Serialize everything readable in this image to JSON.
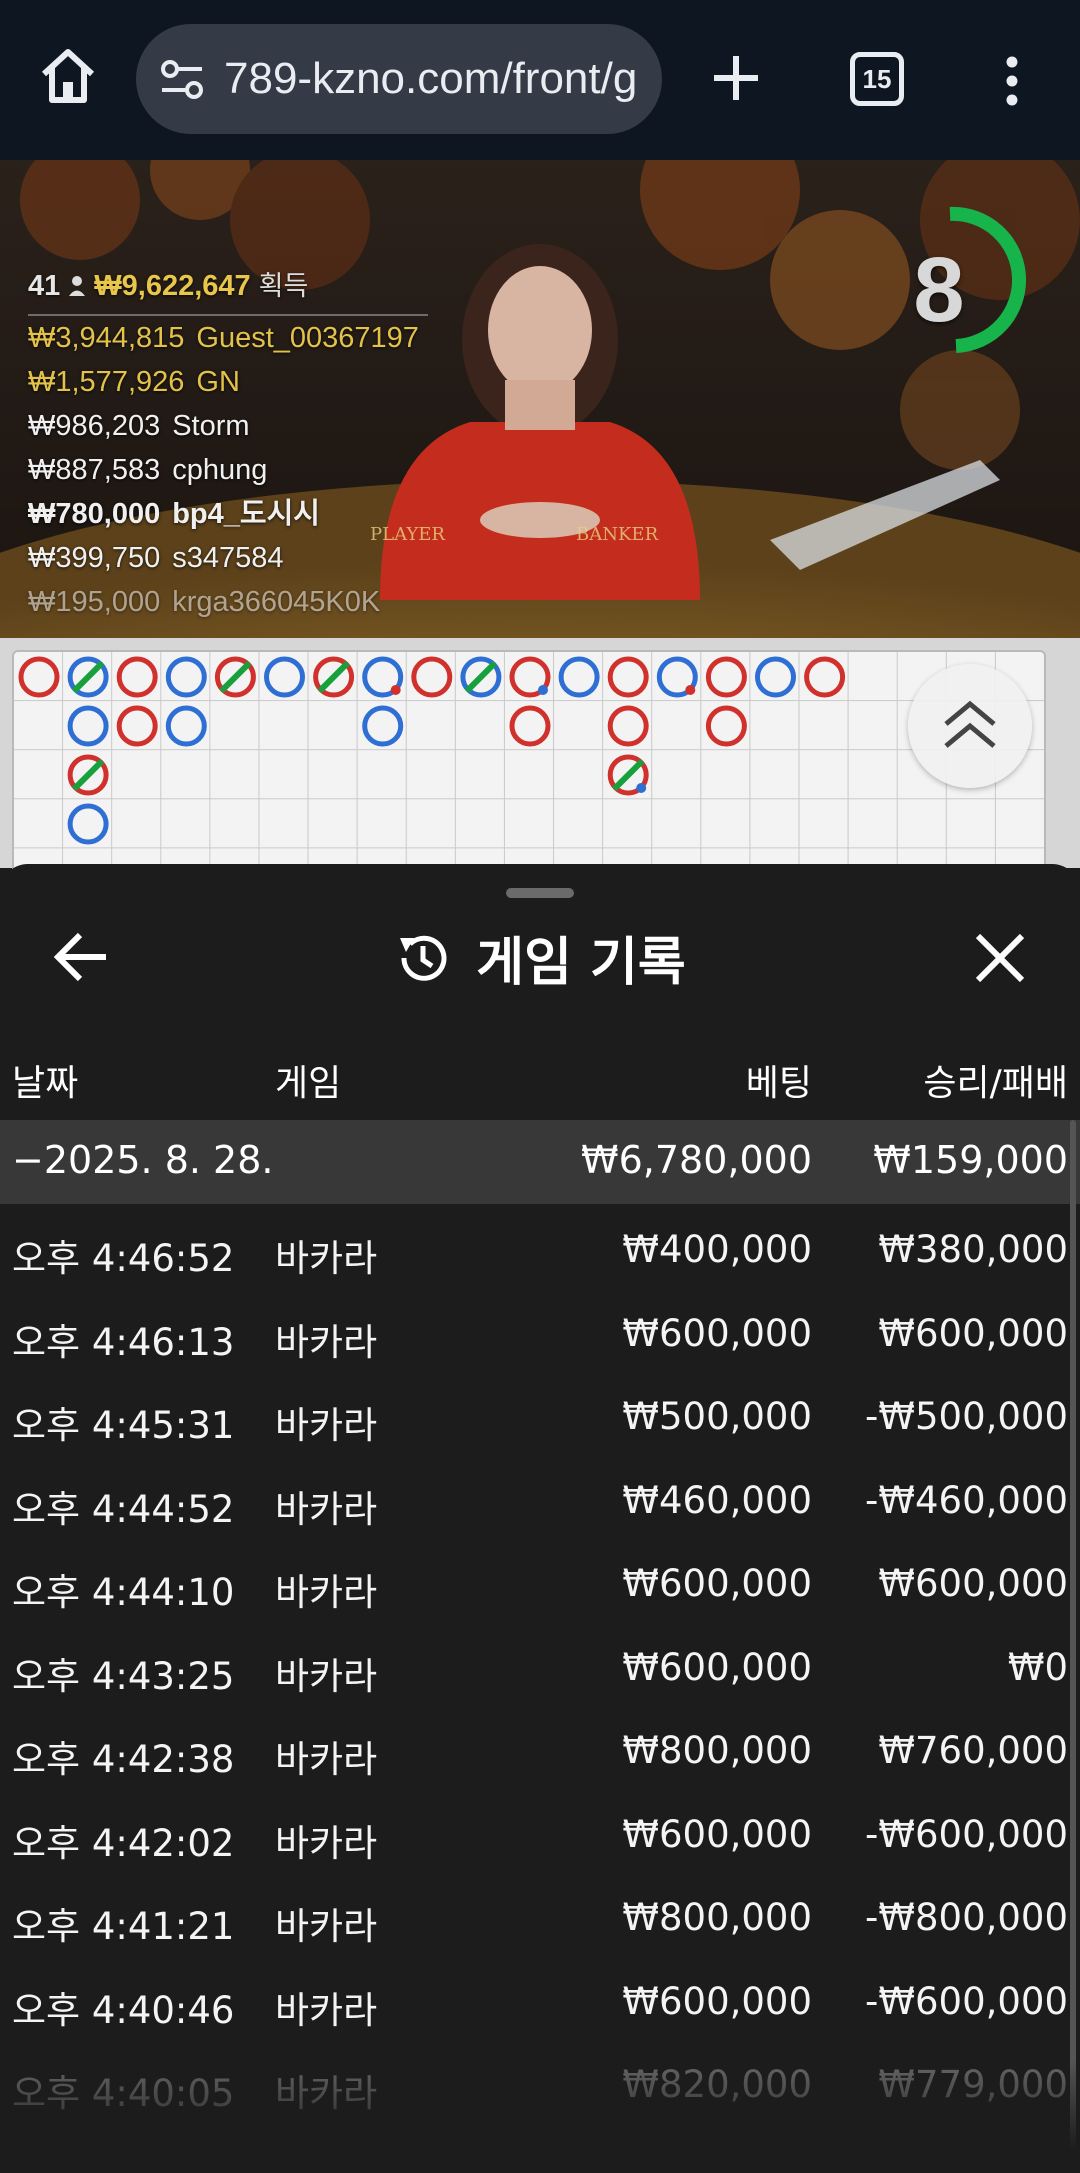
{
  "browser": {
    "url": "789-kzno.com/front/g",
    "tab_count": "15",
    "icons": [
      "home-icon",
      "site-settings-icon",
      "new-tab-icon",
      "tab-switcher-icon",
      "more-menu-icon"
    ]
  },
  "video": {
    "leaderboard": {
      "player_count": "41",
      "total_amount": "₩9,622,647",
      "total_label": "획득",
      "entries": [
        {
          "amount": "₩3,944,815",
          "name": "Guest_00367197"
        },
        {
          "amount": "₩1,577,926",
          "name": "GN"
        },
        {
          "amount": "₩986,203",
          "name": "Storm"
        },
        {
          "amount": "₩887,583",
          "name": "cphung"
        },
        {
          "amount": "₩780,000",
          "name": "bp4_도시시"
        },
        {
          "amount": "₩399,750",
          "name": "s347584"
        },
        {
          "amount": "₩195,000",
          "name": "krga366045K0K"
        }
      ]
    },
    "table_labels": {
      "player": "PLAYER",
      "banker": "BANKER"
    },
    "countdown": "8",
    "colors": {
      "timer": "#17b34b",
      "gold": "#e3c24a"
    }
  },
  "roadmap": {
    "colors": {
      "banker": "#d0312d",
      "player": "#2f6fd3",
      "tie": "#18a03c"
    },
    "columns": [
      {
        "marks": [
          "B"
        ]
      },
      {
        "marks": [
          "P-tie",
          "P",
          "B-tie",
          "P"
        ]
      },
      {
        "marks": [
          "B",
          "B"
        ]
      },
      {
        "marks": [
          "P",
          "P"
        ]
      },
      {
        "marks": [
          "B-tie"
        ]
      },
      {
        "marks": [
          "P"
        ]
      },
      {
        "marks": [
          "B-tie"
        ]
      },
      {
        "marks": [
          "P-pair",
          "P"
        ]
      },
      {
        "marks": [
          "B"
        ]
      },
      {
        "marks": [
          "P-tie"
        ]
      },
      {
        "marks": [
          "B-pair",
          "B"
        ]
      },
      {
        "marks": [
          "P"
        ]
      },
      {
        "marks": [
          "B",
          "B",
          "B-tie-pair"
        ]
      },
      {
        "marks": [
          "P-pair"
        ]
      },
      {
        "marks": [
          "B",
          "B"
        ]
      },
      {
        "marks": [
          "P"
        ]
      },
      {
        "marks": [
          "B"
        ]
      }
    ],
    "scroll_button_icon": "double-chevron-up-icon"
  },
  "sheet": {
    "title": "게임 기록",
    "title_icon": "history-icon",
    "columns": {
      "date": "날짜",
      "game": "게임",
      "bet": "베팅",
      "result": "승리/패배"
    },
    "summary": {
      "date": "−2025. 8. 28.",
      "bet": "₩6,780,000",
      "result": "₩159,000"
    },
    "rows": [
      {
        "time": "오후 4:46:52",
        "game": "바카라",
        "bet": "₩400,000",
        "result": "₩380,000"
      },
      {
        "time": "오후 4:46:13",
        "game": "바카라",
        "bet": "₩600,000",
        "result": "₩600,000"
      },
      {
        "time": "오후 4:45:31",
        "game": "바카라",
        "bet": "₩500,000",
        "result": "-₩500,000"
      },
      {
        "time": "오후 4:44:52",
        "game": "바카라",
        "bet": "₩460,000",
        "result": "-₩460,000"
      },
      {
        "time": "오후 4:44:10",
        "game": "바카라",
        "bet": "₩600,000",
        "result": "₩600,000"
      },
      {
        "time": "오후 4:43:25",
        "game": "바카라",
        "bet": "₩600,000",
        "result": "₩0"
      },
      {
        "time": "오후 4:42:38",
        "game": "바카라",
        "bet": "₩800,000",
        "result": "₩760,000"
      },
      {
        "time": "오후 4:42:02",
        "game": "바카라",
        "bet": "₩600,000",
        "result": "-₩600,000"
      },
      {
        "time": "오후 4:41:21",
        "game": "바카라",
        "bet": "₩800,000",
        "result": "-₩800,000"
      },
      {
        "time": "오후 4:40:46",
        "game": "바카라",
        "bet": "₩600,000",
        "result": "-₩600,000"
      },
      {
        "time": "오후 4:40:05",
        "game": "바카라",
        "bet": "₩820,000",
        "result": "₩779,000"
      }
    ]
  }
}
